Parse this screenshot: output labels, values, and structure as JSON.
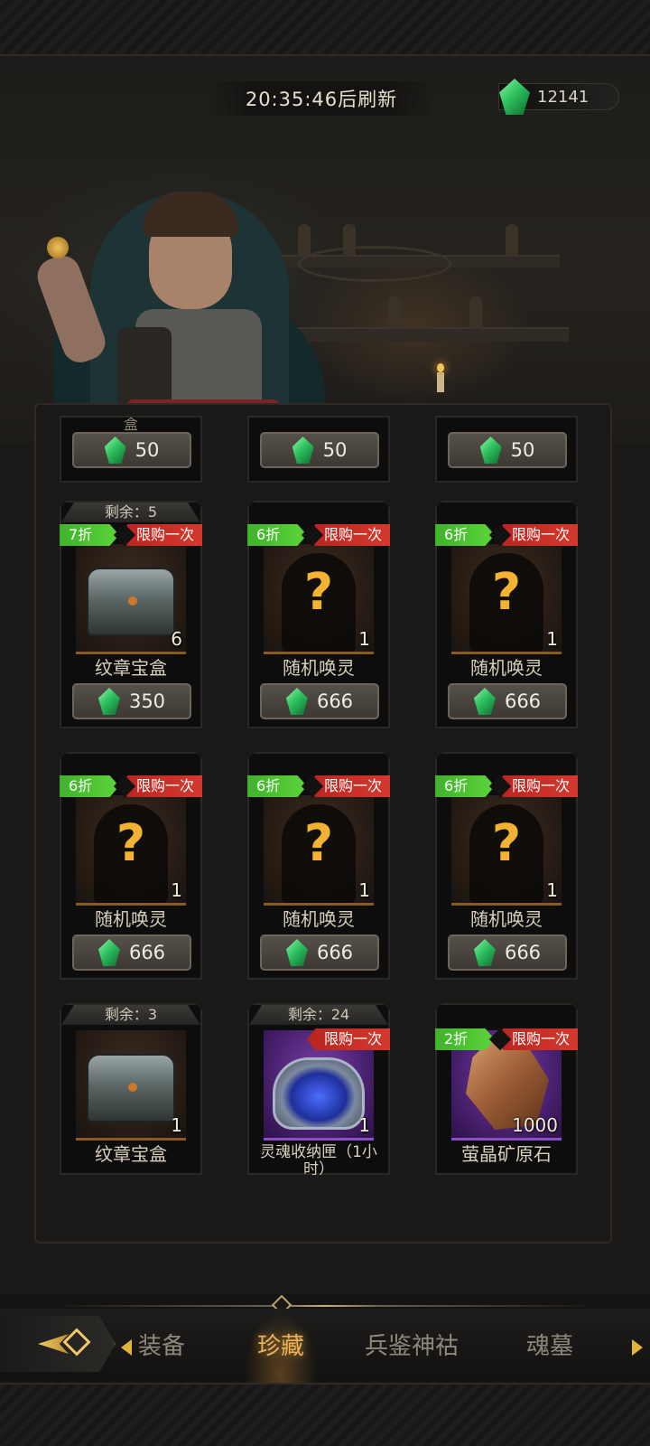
{
  "header": {
    "refresh_timer": "20:35:46后刷新",
    "currency_amount": "12141",
    "currency_icon": "green-crystal-icon"
  },
  "colors": {
    "discount_tag": "#4cc234",
    "limit_tag": "#c72e27",
    "gem": "#2fc25f",
    "active_tab": "#e9b25a"
  },
  "shop": {
    "partial_row": [
      {
        "name": "盒",
        "price": "50"
      },
      {
        "name": "",
        "price": "50"
      },
      {
        "name": "",
        "price": "50"
      }
    ],
    "rows": [
      [
        {
          "remain": "剩余：5",
          "discount": "7折",
          "limit": "限购一次",
          "icon": "chest-icon",
          "qty": "6",
          "name": "纹章宝盒",
          "price": "350"
        },
        {
          "remain": "",
          "discount": "6折",
          "limit": "限购一次",
          "icon": "mystery-summon-icon",
          "qty": "1",
          "name": "随机唤灵",
          "price": "666"
        },
        {
          "remain": "",
          "discount": "6折",
          "limit": "限购一次",
          "icon": "mystery-summon-icon",
          "qty": "1",
          "name": "随机唤灵",
          "price": "666"
        }
      ],
      [
        {
          "remain": "",
          "discount": "6折",
          "limit": "限购一次",
          "icon": "mystery-summon-icon",
          "qty": "1",
          "name": "随机唤灵",
          "price": "666"
        },
        {
          "remain": "",
          "discount": "6折",
          "limit": "限购一次",
          "icon": "mystery-summon-icon",
          "qty": "1",
          "name": "随机唤灵",
          "price": "666"
        },
        {
          "remain": "",
          "discount": "6折",
          "limit": "限购一次",
          "icon": "mystery-summon-icon",
          "qty": "1",
          "name": "随机唤灵",
          "price": "666"
        }
      ],
      [
        {
          "remain": "剩余：3",
          "discount": "",
          "limit": "",
          "icon": "chest-icon",
          "qty": "1",
          "name": "纹章宝盒"
        },
        {
          "remain": "剩余：24",
          "discount": "",
          "limit": "限购一次",
          "icon": "soul-box-icon",
          "qty": "1",
          "name": "灵魂收纳匣（1小时）"
        },
        {
          "remain": "",
          "discount": "2折",
          "limit": "限购一次",
          "icon": "ore-crystal-icon",
          "qty": "1000",
          "name": "萤晶矿原石"
        }
      ]
    ]
  },
  "nav": {
    "back_icon": "back-arrow-icon",
    "tabs": [
      {
        "label": "装备",
        "active": false
      },
      {
        "label": "珍藏",
        "active": true
      },
      {
        "label": "兵鉴神祜",
        "active": false
      },
      {
        "label": "魂墓",
        "active": false
      }
    ]
  }
}
